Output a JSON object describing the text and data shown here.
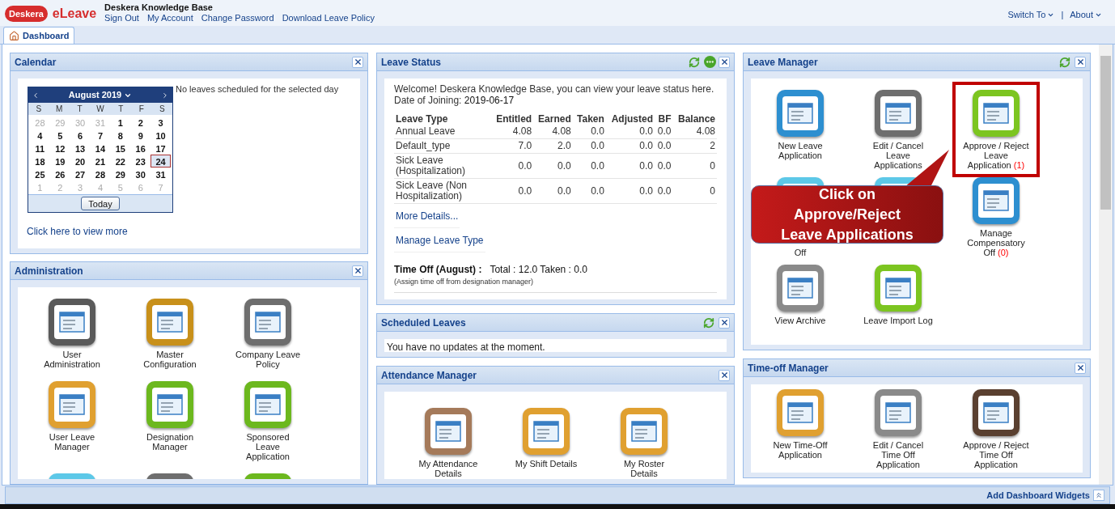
{
  "header": {
    "logo_mark": "Deskera",
    "app_name": "eLeave",
    "company": "Deskera Knowledge Base",
    "links": [
      "Sign Out",
      "My Account",
      "Change Password",
      "Download Leave Policy"
    ],
    "menus": [
      "Switch To",
      "About"
    ],
    "separator": "|"
  },
  "tabs": [
    {
      "label": "Dashboard",
      "selected": true
    }
  ],
  "calendar": {
    "title": "Calendar",
    "month": "August 2019",
    "weekdays": [
      "S",
      "M",
      "T",
      "W",
      "T",
      "F",
      "S"
    ],
    "days": [
      {
        "d": "28",
        "other": true,
        "selected": false
      },
      {
        "d": "29",
        "other": true,
        "selected": false
      },
      {
        "d": "30",
        "other": true,
        "selected": false
      },
      {
        "d": "31",
        "other": true,
        "selected": false
      },
      {
        "d": "1",
        "other": false,
        "selected": false
      },
      {
        "d": "2",
        "other": false,
        "selected": false
      },
      {
        "d": "3",
        "other": false,
        "selected": false
      },
      {
        "d": "4",
        "other": false,
        "selected": false
      },
      {
        "d": "5",
        "other": false,
        "selected": false
      },
      {
        "d": "6",
        "other": false,
        "selected": false
      },
      {
        "d": "7",
        "other": false,
        "selected": false
      },
      {
        "d": "8",
        "other": false,
        "selected": false
      },
      {
        "d": "9",
        "other": false,
        "selected": false
      },
      {
        "d": "10",
        "other": false,
        "selected": false
      },
      {
        "d": "11",
        "other": false,
        "selected": false
      },
      {
        "d": "12",
        "other": false,
        "selected": false
      },
      {
        "d": "13",
        "other": false,
        "selected": false
      },
      {
        "d": "14",
        "other": false,
        "selected": false
      },
      {
        "d": "15",
        "other": false,
        "selected": false
      },
      {
        "d": "16",
        "other": false,
        "selected": false
      },
      {
        "d": "17",
        "other": false,
        "selected": false
      },
      {
        "d": "18",
        "other": false,
        "selected": false
      },
      {
        "d": "19",
        "other": false,
        "selected": false
      },
      {
        "d": "20",
        "other": false,
        "selected": false
      },
      {
        "d": "21",
        "other": false,
        "selected": false
      },
      {
        "d": "22",
        "other": false,
        "selected": false
      },
      {
        "d": "23",
        "other": false,
        "selected": false
      },
      {
        "d": "24",
        "other": false,
        "selected": true
      },
      {
        "d": "25",
        "other": false,
        "selected": false
      },
      {
        "d": "26",
        "other": false,
        "selected": false
      },
      {
        "d": "27",
        "other": false,
        "selected": false
      },
      {
        "d": "28",
        "other": false,
        "selected": false
      },
      {
        "d": "29",
        "other": false,
        "selected": false
      },
      {
        "d": "30",
        "other": false,
        "selected": false
      },
      {
        "d": "31",
        "other": false,
        "selected": false
      },
      {
        "d": "1",
        "other": true,
        "selected": false
      },
      {
        "d": "2",
        "other": true,
        "selected": false
      },
      {
        "d": "3",
        "other": true,
        "selected": false
      },
      {
        "d": "4",
        "other": true,
        "selected": false
      },
      {
        "d": "5",
        "other": true,
        "selected": false
      },
      {
        "d": "6",
        "other": true,
        "selected": false
      },
      {
        "d": "7",
        "other": true,
        "selected": false
      }
    ],
    "today_button": "Today",
    "message": "No leaves scheduled for the selected day",
    "more_link": "Click here to view more"
  },
  "administration": {
    "title": "Administration",
    "items": [
      {
        "label": "User Administration",
        "color": "#5a5a5a"
      },
      {
        "label": "Master Configuration",
        "color": "#c8901a"
      },
      {
        "label": "Company Leave Policy",
        "color": "#6e6e6e"
      },
      {
        "label": "User Leave Manager",
        "color": "#e0a030"
      },
      {
        "label": "Designation Manager",
        "color": "#6cb81e"
      },
      {
        "label": "Sponsored Leave Application",
        "color": "#6cb81e"
      },
      {
        "color": "#5cc8e8"
      },
      {
        "color": "#6e6e6e"
      },
      {
        "color": "#6cb81e"
      }
    ]
  },
  "leave_status": {
    "title": "Leave Status",
    "welcome": "Welcome! Deskera Knowledge Base, you can view your leave status here.",
    "joining_label": "Date of Joining:",
    "joining_date": "2019-06-17",
    "columns": [
      "Leave Type",
      "Entitled",
      "Earned",
      "Taken",
      "Adjusted",
      "BF",
      "Balance"
    ],
    "rows": [
      [
        "Annual Leave",
        "4.08",
        "4.08",
        "0.0",
        "0.0",
        "0.0",
        "4.08"
      ],
      [
        "Default_type",
        "7.0",
        "2.0",
        "0.0",
        "0.0",
        "0.0",
        "2"
      ],
      [
        "Sick Leave (Hospitalization)",
        "0.0",
        "0.0",
        "0.0",
        "0.0",
        "0.0",
        "0"
      ],
      [
        "Sick Leave (Non Hospitalization)",
        "0.0",
        "0.0",
        "0.0",
        "0.0",
        "0.0",
        "0"
      ]
    ],
    "links": [
      "More Details...",
      "Manage Leave Type"
    ],
    "time_off_label": "Time Off (August) :",
    "time_off_values": "Total : 12.0 Taken : 0.0",
    "time_off_note": "(Assign time off from designation manager)"
  },
  "scheduled_leaves": {
    "title": "Scheduled Leaves",
    "message": "You have no updates at the moment."
  },
  "attendance_manager": {
    "title": "Attendance Manager",
    "items": [
      {
        "label": "My Attendance Details",
        "color": "#a57a5a"
      },
      {
        "label": "My Shift Details",
        "color": "#e0a030"
      },
      {
        "label": "My Roster Details",
        "color": "#e0a030"
      }
    ]
  },
  "leave_manager": {
    "title": "Leave Manager",
    "items": [
      {
        "label": "New Leave Application",
        "color": "#2d8fd0",
        "highlighted": false
      },
      {
        "label": "Edit / Cancel Leave Applications",
        "color": "#6e6e6e",
        "highlighted": false
      },
      {
        "label": "Approve / Reject Leave Application",
        "count": "(1)",
        "color": "#7cc520",
        "highlighted": true
      },
      {
        "kind": "covered",
        "label": "Off",
        "color": "#5cc8e8",
        "highlighted": false
      },
      {
        "color": "#5cc8e8",
        "highlighted": false
      },
      {
        "label": "Manage Compensatory Off",
        "count": "(0)",
        "color": "#2d8fd0",
        "highlighted": false
      },
      {
        "label": "View Archive",
        "color": "#8a8a8a",
        "highlighted": false
      },
      {
        "label": "Leave Import Log",
        "color": "#7cc520",
        "highlighted": false
      }
    ],
    "callout": [
      "Click on",
      "Approve/Reject",
      "Leave Applications"
    ]
  },
  "time_off_manager": {
    "title": "Time-off Manager",
    "items": [
      {
        "label": "New Time-Off Application",
        "color": "#e0a030"
      },
      {
        "label": "Edit / Cancel Time Off Application",
        "color": "#8a8a8a"
      },
      {
        "label": "Approve / Reject Time Off Application",
        "color": "#5a4030"
      }
    ]
  },
  "footer": {
    "add_widgets": "Add Dashboard Widgets"
  }
}
